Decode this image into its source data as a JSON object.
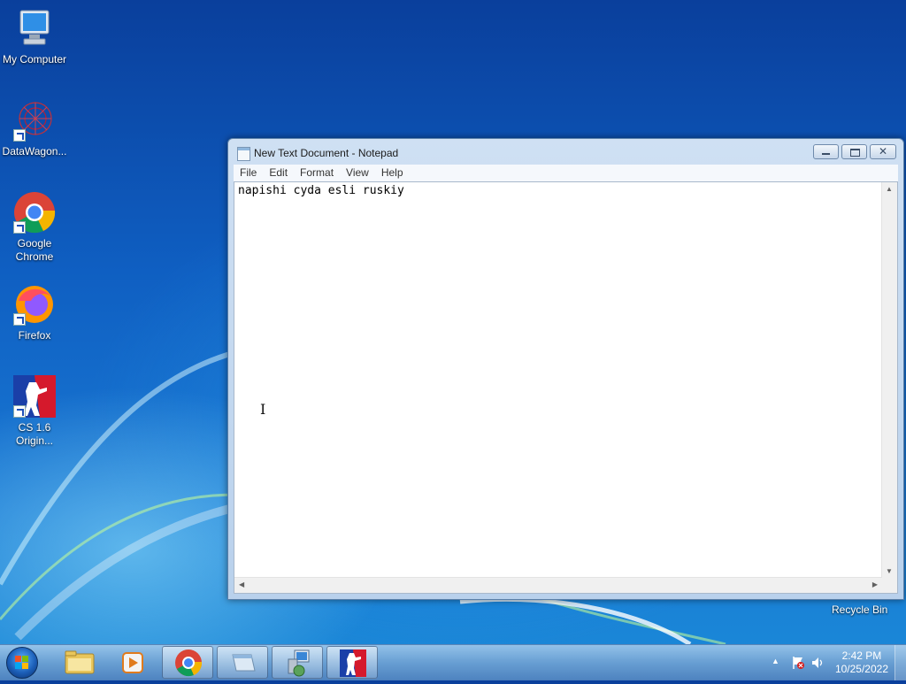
{
  "desktop": {
    "icons": [
      {
        "label": "My Computer",
        "icon": "computer-icon"
      },
      {
        "label": "DataWagon...",
        "icon": "datawagon-icon"
      },
      {
        "label": "Google Chrome",
        "icon": "chrome-icon"
      },
      {
        "label": "Firefox",
        "icon": "firefox-icon"
      },
      {
        "label": "CS 1.6 Origin...",
        "icon": "counter-strike-icon"
      }
    ],
    "recycle_bin_label": "Recycle Bin"
  },
  "window": {
    "title": "New Text Document - Notepad",
    "menu": [
      "File",
      "Edit",
      "Format",
      "View",
      "Help"
    ],
    "content": "napishi cyda esli ruskiy",
    "minimize_glyph": "▭",
    "maximize_glyph": "▣",
    "close_glyph": "✕"
  },
  "taskbar": {
    "items": [
      {
        "name": "windows-explorer",
        "icon": "folder-icon",
        "active": false
      },
      {
        "name": "media-player",
        "icon": "media-player-icon",
        "active": false
      },
      {
        "name": "google-chrome",
        "icon": "chrome-icon",
        "active": true
      },
      {
        "name": "notepad",
        "icon": "notepad-icon",
        "active": true
      },
      {
        "name": "network-app",
        "icon": "network-icon",
        "active": true
      },
      {
        "name": "counter-strike",
        "icon": "counter-strike-icon",
        "active": true
      }
    ],
    "clock_time": "2:42 PM",
    "clock_date": "10/25/2022",
    "tray_show_hidden": "▲"
  },
  "colors": {
    "desktop_blue": "#1169c8",
    "taskbar": "#8ab4dd",
    "window_frame": "#c4d8ef"
  }
}
